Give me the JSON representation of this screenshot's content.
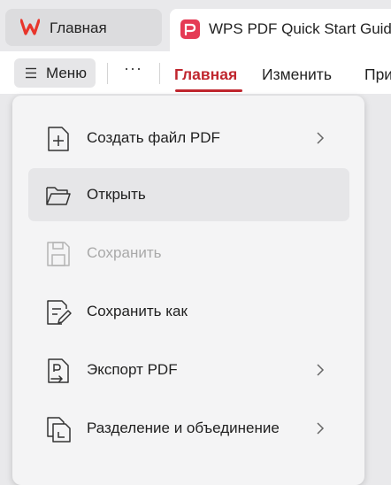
{
  "tabs": {
    "home_label": "Главная",
    "doc_label": "WPS PDF Quick Start Guid"
  },
  "toolbar": {
    "menu_label": "Меню",
    "more_label": "···",
    "ribbon_tabs": [
      {
        "label": "Главная",
        "active": true
      },
      {
        "label": "Изменить",
        "active": false
      },
      {
        "label": "При",
        "active": false
      }
    ]
  },
  "menu": {
    "items": [
      {
        "label": "Создать файл PDF",
        "icon": "new-file-icon",
        "submenu": true,
        "disabled": false
      },
      {
        "label": "Открыть",
        "icon": "folder-open-icon",
        "submenu": false,
        "disabled": false,
        "highlighted": true
      },
      {
        "label": "Сохранить",
        "icon": "save-icon",
        "submenu": false,
        "disabled": true
      },
      {
        "label": "Сохранить как",
        "icon": "save-as-icon",
        "submenu": false,
        "disabled": false
      },
      {
        "label": "Экспорт PDF",
        "icon": "export-pdf-icon",
        "submenu": true,
        "disabled": false
      },
      {
        "label": "Разделение и объединение",
        "icon": "split-merge-icon",
        "submenu": true,
        "disabled": false
      }
    ]
  },
  "colors": {
    "accent": "#c0262e",
    "wps_logo": "#e8352b",
    "pdf_logo": "#e53b55",
    "menu_bg": "#f4f4f5",
    "highlight_bg": "#e6e6e8"
  }
}
